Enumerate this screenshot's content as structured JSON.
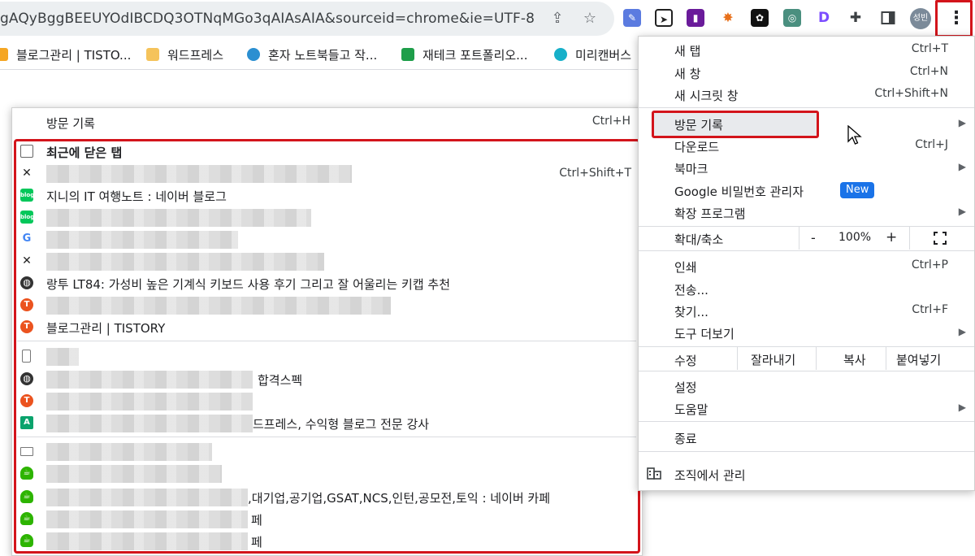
{
  "toolbar": {
    "url": "gAQyBggBEEUYOdIBCDQ3OTNqMGo3qAIAsAIA&sourceid=chrome&ie=UTF-8",
    "profile_initials": "성빈",
    "extension_d_label": "D"
  },
  "bookmarks": [
    {
      "label": "블로그관리 | TISTO...",
      "color": "#f5a623"
    },
    {
      "label": "워드프레스",
      "color": "#f5c35b"
    },
    {
      "label": "혼자 노트북들고 작...",
      "color": "#2b8fd1"
    },
    {
      "label": "재테크 포트폴리오...",
      "color": "#1e9e4a"
    },
    {
      "label": "미리캔버스",
      "color": "#17b0c9"
    }
  ],
  "history_menu": {
    "title": "방문 기록",
    "title_shortcut": "Ctrl+H",
    "rows": [
      {
        "icon": "tab-icon",
        "text": "최근에 닫은 탭",
        "shortcut": "",
        "bold": true
      },
      {
        "icon": "butterfly-icon",
        "text": "",
        "shortcut": "Ctrl+Shift+T"
      },
      {
        "icon": "naver-blog-icon",
        "text": "지니의 IT 여행노트 : 네이버 블로그",
        "shortcut": ""
      },
      {
        "icon": "naver-blog-icon",
        "text": "",
        "shortcut": ""
      },
      {
        "icon": "google-icon",
        "text": "",
        "shortcut": ""
      },
      {
        "icon": "butterfly-icon",
        "text": "",
        "shortcut": ""
      },
      {
        "icon": "globe-icon",
        "text": "랑투 LT84: 가성비 높은 기계식 키보드 사용 후기 그리고 잘 어울리는 키캡 추천",
        "shortcut": ""
      },
      {
        "icon": "tistory-icon",
        "text": "",
        "shortcut": ""
      },
      {
        "icon": "tistory-icon",
        "text": "블로그관리 | TISTORY",
        "shortcut": ""
      },
      {
        "icon": "phone-icon",
        "text": "",
        "shortcut": ""
      },
      {
        "icon": "globe-icon",
        "text": "합격스펙",
        "shortcut": ""
      },
      {
        "icon": "tistory-icon",
        "text": "",
        "shortcut": ""
      },
      {
        "icon": "a-icon",
        "text": "드프레스, 수익형 블로그 전문 강사",
        "shortcut": ""
      },
      {
        "icon": "laptop-icon",
        "text": "",
        "shortcut": ""
      },
      {
        "icon": "naver-cafe-icon",
        "text": "",
        "shortcut": ""
      },
      {
        "icon": "naver-cafe-icon",
        "text": ",대기업,공기업,GSAT,NCS,인턴,공모전,토익 : 네이버 카페",
        "shortcut": ""
      },
      {
        "icon": "naver-cafe-icon",
        "text": "페",
        "shortcut": ""
      },
      {
        "icon": "naver-cafe-icon",
        "text": "페",
        "shortcut": ""
      }
    ],
    "icon_labels": {
      "naver_blog": "blog",
      "tistory": "T",
      "a": "A",
      "google": "G"
    }
  },
  "chrome_menu": {
    "new_tab": {
      "label": "새 탭",
      "shortcut": "Ctrl+T"
    },
    "new_window": {
      "label": "새 창",
      "shortcut": "Ctrl+N"
    },
    "incognito": {
      "label": "새 시크릿 창",
      "shortcut": "Ctrl+Shift+N"
    },
    "history": {
      "label": "방문 기록"
    },
    "downloads": {
      "label": "다운로드",
      "shortcut": "Ctrl+J"
    },
    "bookmarks": {
      "label": "북마크"
    },
    "password_manager": {
      "label": "Google 비밀번호 관리자",
      "badge": "New"
    },
    "extensions": {
      "label": "확장 프로그램"
    },
    "zoom": {
      "label": "확대/축소",
      "minus": "-",
      "value": "100%",
      "plus": "+"
    },
    "print": {
      "label": "인쇄",
      "shortcut": "Ctrl+P"
    },
    "cast": {
      "label": "전송..."
    },
    "find": {
      "label": "찾기...",
      "shortcut": "Ctrl+F"
    },
    "more_tools": {
      "label": "도구 더보기"
    },
    "edit": {
      "label": "수정",
      "cut": "잘라내기",
      "copy": "복사",
      "paste": "붙여넣기"
    },
    "settings": {
      "label": "설정"
    },
    "help": {
      "label": "도움말"
    },
    "exit": {
      "label": "종료"
    },
    "managed": {
      "label": "조직에서 관리"
    }
  },
  "accent": "#d3141b"
}
